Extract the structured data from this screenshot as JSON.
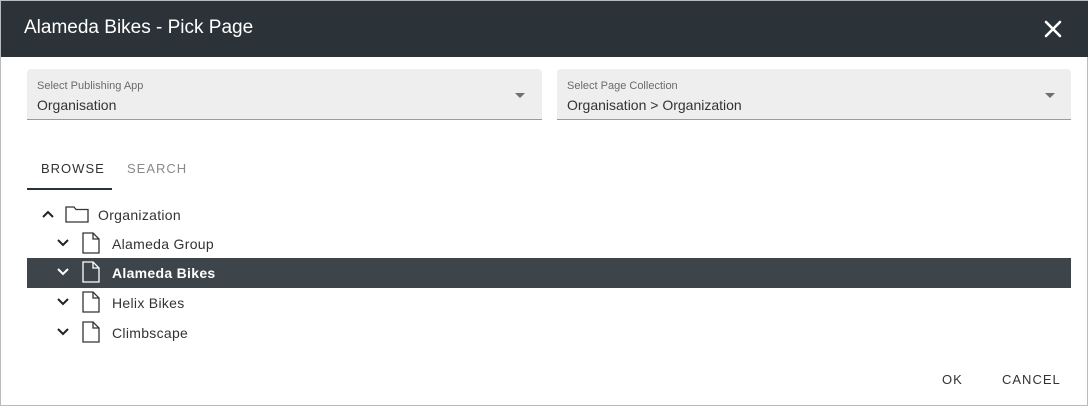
{
  "dialog": {
    "title": "Alameda Bikes - Pick Page",
    "close_icon": "close-icon"
  },
  "publishing_app": {
    "label": "Select Publishing App",
    "value": "Organisation"
  },
  "page_collection": {
    "label": "Select Page Collection",
    "value": "Organisation > Organization"
  },
  "tabs": [
    {
      "label": "BROWSE",
      "active": true
    },
    {
      "label": "SEARCH",
      "active": false
    }
  ],
  "tree": {
    "root": {
      "label": "Organization",
      "expanded": true,
      "icon": "folder-icon"
    },
    "children": [
      {
        "label": "Alameda Group",
        "selected": false,
        "icon": "page-icon"
      },
      {
        "label": "Alameda Bikes",
        "selected": true,
        "icon": "page-icon"
      },
      {
        "label": "Helix Bikes",
        "selected": false,
        "icon": "page-icon"
      },
      {
        "label": "Climbscape",
        "selected": false,
        "icon": "page-icon"
      }
    ]
  },
  "actions": {
    "ok_label": "OK",
    "cancel_label": "CANCEL"
  },
  "colors": {
    "titlebar": "#2b3338",
    "selected_row": "#3d454b",
    "select_bg": "#eeeeee"
  }
}
